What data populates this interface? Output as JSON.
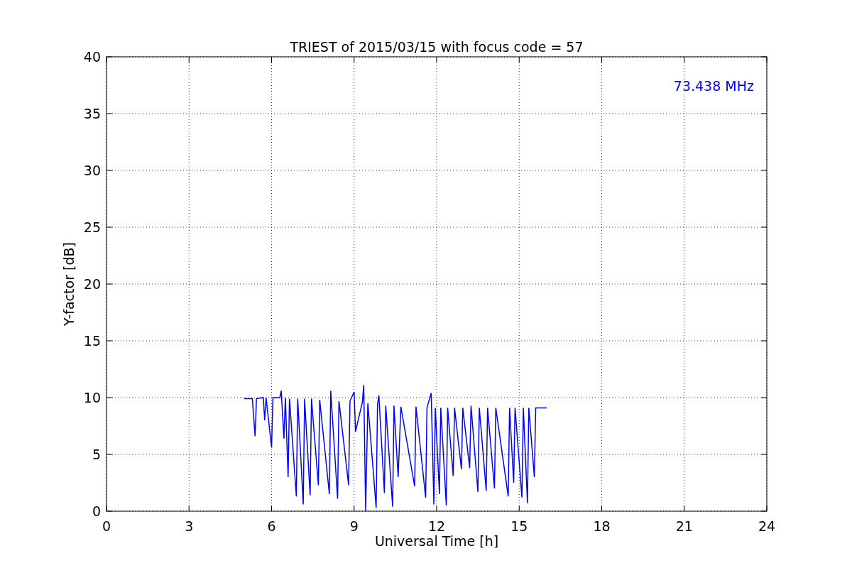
{
  "chart_data": {
    "type": "line",
    "title": "TRIEST of 2015/03/15 with focus code = 57",
    "xlabel": "Universal Time [h]",
    "ylabel": "Y-factor [dB]",
    "x": [
      5.0,
      5.3,
      5.4,
      5.45,
      5.7,
      5.75,
      5.8,
      6.0,
      6.05,
      6.3,
      6.35,
      6.45,
      6.5,
      6.6,
      6.65,
      6.9,
      6.95,
      7.15,
      7.2,
      7.4,
      7.45,
      7.7,
      7.75,
      8.1,
      8.15,
      8.4,
      8.45,
      8.8,
      8.85,
      9.0,
      9.05,
      9.3,
      9.35,
      9.42,
      9.5,
      9.8,
      9.85,
      9.9,
      10.1,
      10.15,
      10.4,
      10.45,
      10.6,
      10.7,
      11.2,
      11.25,
      11.6,
      11.65,
      11.8,
      11.9,
      11.95,
      12.1,
      12.15,
      12.35,
      12.4,
      12.6,
      12.65,
      12.9,
      12.95,
      13.2,
      13.25,
      13.5,
      13.55,
      13.8,
      13.85,
      14.1,
      14.15,
      14.6,
      14.65,
      14.8,
      14.85,
      15.1,
      15.15,
      15.3,
      15.35,
      15.55,
      15.6,
      16.0
    ],
    "series": [
      {
        "name": "73.438 MHz",
        "color": "#0000ff",
        "values": [
          9.9,
          9.9,
          6.6,
          9.9,
          10.0,
          8.0,
          10.0,
          5.6,
          10.0,
          10.0,
          10.6,
          6.4,
          10.0,
          3.0,
          9.9,
          1.3,
          9.9,
          0.6,
          9.9,
          1.4,
          9.9,
          2.3,
          9.8,
          1.5,
          10.6,
          1.1,
          9.7,
          2.3,
          9.7,
          10.5,
          7.0,
          9.6,
          11.1,
          0.0,
          9.5,
          0.3,
          9.4,
          10.2,
          1.6,
          9.3,
          0.4,
          9.3,
          3.0,
          9.2,
          2.2,
          9.2,
          1.2,
          9.1,
          10.4,
          0.6,
          9.1,
          1.5,
          9.1,
          0.5,
          9.1,
          3.1,
          9.1,
          3.7,
          9.1,
          3.8,
          9.3,
          1.7,
          9.1,
          1.8,
          9.1,
          2.0,
          9.1,
          1.3,
          9.1,
          2.5,
          9.1,
          1.2,
          9.1,
          0.7,
          9.1,
          3.0,
          9.1,
          9.1
        ]
      }
    ],
    "xlim": [
      0,
      24
    ],
    "ylim": [
      0,
      40
    ],
    "xticks": [
      0,
      3,
      6,
      9,
      12,
      15,
      18,
      21,
      24
    ],
    "yticks": [
      0,
      5,
      10,
      15,
      20,
      25,
      30,
      35,
      40
    ],
    "grid": true
  }
}
